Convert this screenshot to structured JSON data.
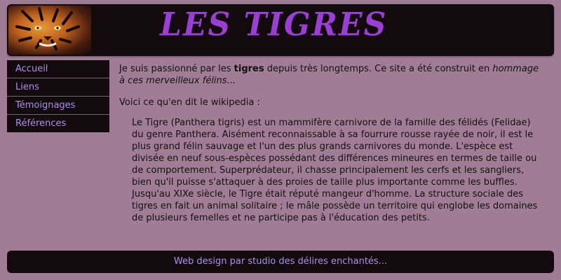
{
  "header": {
    "title": "LES TIGRES"
  },
  "nav": {
    "items": [
      {
        "label": "Accueil"
      },
      {
        "label": "Liens"
      },
      {
        "label": "Témoignages"
      },
      {
        "label": "Références"
      }
    ]
  },
  "content": {
    "intro_before": "Je suis passionné par les ",
    "intro_bold": "tigres",
    "intro_middle": " depuis très longtemps. Ce site a été construit en ",
    "intro_italic": "hommage à ces merveilleux félins...",
    "wiki_label": "Voici ce qu'en dit le wikipedia :",
    "quote": "Le Tigre (Panthera tigris) est un mammifère carnivore de la famille des félidés (Felidae) du genre Panthera. Aisément reconnaissable à sa fourrure rousse rayée de noir, il est le plus grand félin sauvage et l'un des plus grands carnivores du monde. L'espèce est divisée en neuf sous-espèces possédant des différences mineures en termes de taille ou de comportement. Superprédateur, il chasse principalement les cerfs et les sangliers, bien qu'il puisse s'attaquer à des proies de taille plus importante comme les buffles. Jusqu'au XIXe siècle, le Tigre était réputé mangeur d'homme. La structure sociale des tigres en fait un animal solitaire ; le mâle possède un territoire qui englobe les domaines de plusieurs femelles et ne participe pas à l'éducation des petits."
  },
  "footer": {
    "text": "Web design par studio des délires enchantés..."
  },
  "colors": {
    "background": "#a07d95",
    "panel": "#120a0c",
    "title": "#9a3fd4",
    "link": "#b48cf0"
  }
}
